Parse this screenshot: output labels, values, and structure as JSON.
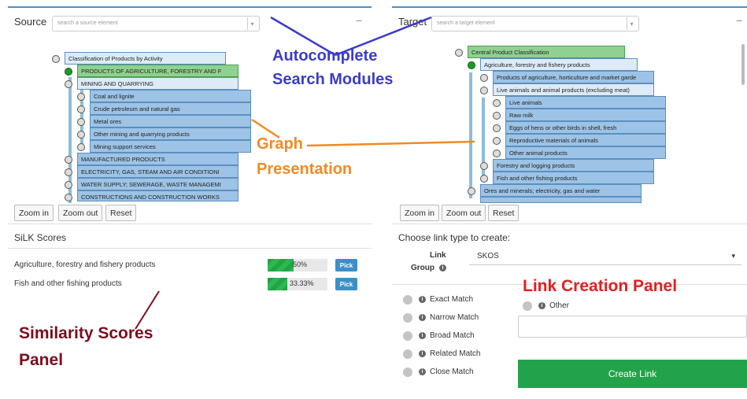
{
  "source": {
    "title": "Source",
    "search_placeholder": "search a source element",
    "collapse_label": "−",
    "tree": {
      "root": "Classification of Products by Activity",
      "l1_selected": "PRODUCTS OF AGRICULTURE, FORESTRY AND F",
      "l1_open": "MINING AND QUARRYING",
      "children": [
        "Coal and lignite",
        "Crude petroleum and natural gas",
        "Metal ores",
        "Other mining and quarrying products",
        "Mining support services"
      ],
      "siblings": [
        "MANUFACTURED PRODUCTS",
        "ELECTRICITY, GAS, STEAM AND AIR CONDITIONI",
        "WATER SUPPLY; SEWERAGE, WASTE MANAGEMI",
        "CONSTRUCTIONS AND CONSTRUCTION WORKS"
      ]
    },
    "buttons": {
      "zoom_in": "Zoom in",
      "zoom_out": "Zoom out",
      "reset": "Reset"
    }
  },
  "target": {
    "title": "Target",
    "search_placeholder": "search a target element",
    "collapse_label": "−",
    "tree": {
      "root": "Central Product Classification",
      "l1_selected": "Agriculture, forestry and fishery products",
      "l2": [
        "Products of agriculture, horticulture and market garde",
        "Live animals and animal products (excluding meat)"
      ],
      "l3": [
        "Live animals",
        "Raw milk",
        "Eggs of hens or other birds in shell, fresh",
        "Reproductive materials of animals",
        "Other animal products"
      ],
      "l2b": [
        "Forestry and logging products",
        "Fish and other fishing products"
      ],
      "l1b": "Ores and minerals; electricity, gas and water"
    },
    "buttons": {
      "zoom_in": "Zoom in",
      "zoom_out": "Zoom out",
      "reset": "Reset"
    }
  },
  "scores": {
    "title": "SiLK Scores",
    "rows": [
      {
        "label": "Agriculture, forestry and fishery products",
        "value": 50,
        "text": "50%",
        "pick": "Pick"
      },
      {
        "label": "Fish and other fishing products",
        "value": 33.33,
        "text": "33.33%",
        "pick": "Pick"
      }
    ]
  },
  "link": {
    "title": "Choose link type to create:",
    "group_label_1": "Link",
    "group_label_2": "Group",
    "group_value": "SKOS",
    "options": [
      "Exact Match",
      "Narrow Match",
      "Broad Match",
      "Related Match",
      "Close Match"
    ],
    "other_label": "Other",
    "create_label": "Create Link"
  },
  "annotations": {
    "autocomplete_1": "Autocomplete",
    "autocomplete_2": "Search Modules",
    "graph_1": "Graph",
    "graph_2": "Presentation",
    "similarity_1": "Similarity Scores",
    "similarity_2": "Panel",
    "link_panel": "Link Creation Panel"
  },
  "colors": {
    "accent": "#4a8fc9",
    "create": "#22a34a",
    "annotation_blue": "#3c3cc8",
    "annotation_orange": "#f08a24",
    "annotation_red": "#e02020",
    "annotation_maroon": "#7a0f1e"
  }
}
